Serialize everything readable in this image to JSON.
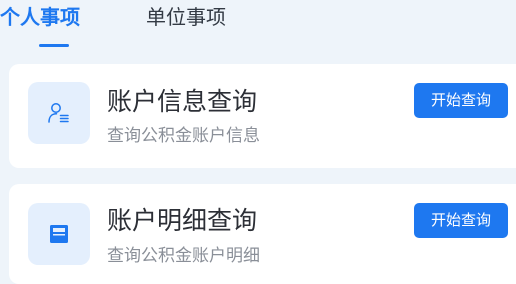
{
  "tabs": [
    {
      "label": "个人事项",
      "active": true
    },
    {
      "label": "单位事项",
      "active": false
    }
  ],
  "accent_color": "#1e78f0",
  "items": [
    {
      "title": "账户信息查询",
      "subtitle": "查询公积金账户信息",
      "button_label": "开始查询",
      "icon": "user-info-icon"
    },
    {
      "title": "账户明细查询",
      "subtitle": "查询公积金账户明细",
      "button_label": "开始查询",
      "icon": "ledger-icon"
    }
  ]
}
